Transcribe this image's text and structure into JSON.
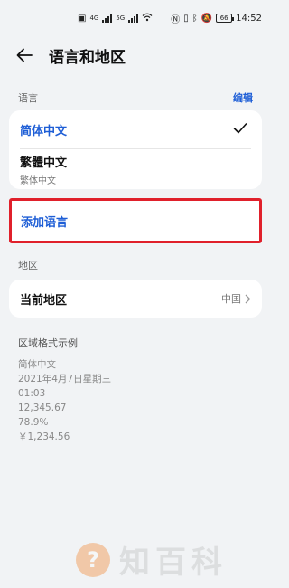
{
  "status": {
    "left_text_1": "4G",
    "left_text_2": "5G",
    "battery": "66",
    "time": "14:52"
  },
  "header": {
    "title": "语言和地区"
  },
  "language_section": {
    "label": "语言",
    "edit_label": "编辑",
    "items": [
      {
        "name": "简体中文",
        "selected": true
      },
      {
        "name": "繁體中文",
        "subtitle": "繁体中文"
      }
    ],
    "add_label": "添加语言"
  },
  "region_section": {
    "label": "地区",
    "row_label": "当前地区",
    "row_value": "中国"
  },
  "format_section": {
    "title": "区域格式示例",
    "lines": [
      "简体中文",
      "2021年4月7日星期三",
      "01:03",
      "12,345.67",
      "78.9%",
      "￥1,234.56"
    ]
  },
  "watermark": {
    "glyph": "?",
    "text": "知百科"
  },
  "colors": {
    "accent": "#1e5ed6",
    "highlight_border": "#e0202b",
    "background": "#f1f3f5"
  }
}
